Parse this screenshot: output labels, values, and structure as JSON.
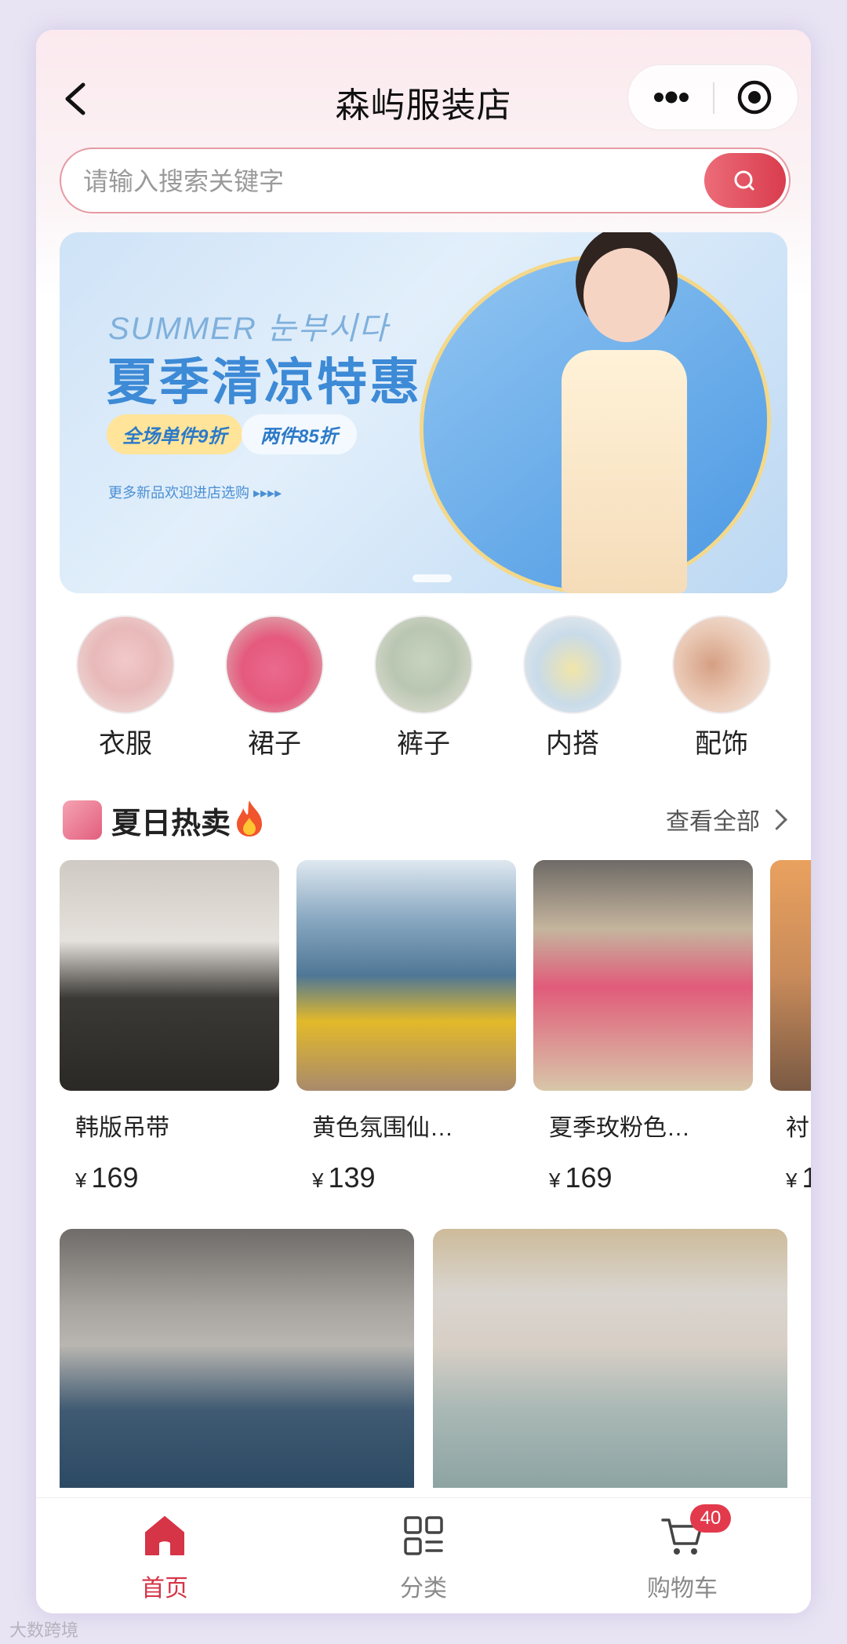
{
  "header": {
    "title": "森屿服装店"
  },
  "search": {
    "placeholder": "请输入搜索关键字"
  },
  "banner": {
    "script_text": "SUMMER 눈부시다",
    "headline": "夏季清凉特惠",
    "promo_1": "全场单件9折",
    "promo_2": "两件85折",
    "subtext": "更多新品欢迎进店选购 ▸▸▸▸"
  },
  "categories": [
    {
      "label": "衣服",
      "color": "#e8b9b9"
    },
    {
      "label": "裙子",
      "color": "#e5597e"
    },
    {
      "label": "裤子",
      "color": "#b9c6b1"
    },
    {
      "label": "内搭",
      "color": "#c9dbe9"
    },
    {
      "label": "配饰",
      "color": "#e9c7b3"
    }
  ],
  "section": {
    "title": "夏日热卖",
    "view_all": "查看全部"
  },
  "products": [
    {
      "name": "韩版吊带",
      "currency": "¥",
      "price": "169",
      "color": "#d8d4cf"
    },
    {
      "name": "黄色氛围仙…",
      "currency": "¥",
      "price": "139",
      "color": "#5f86a6"
    },
    {
      "name": "夏季玫粉色…",
      "currency": "¥",
      "price": "169",
      "color": "#d87f85"
    },
    {
      "name": "衬",
      "currency": "¥",
      "price": "1",
      "color": "#c98b5a"
    }
  ],
  "big_cards": [
    {
      "color": "#7d8e9a"
    },
    {
      "color": "#c9c7c3"
    }
  ],
  "tabbar": {
    "home": "首页",
    "category": "分类",
    "cart": "购物车",
    "cart_count": "40"
  },
  "colors": {
    "accent": "#d63447"
  },
  "watermark": "大数跨境"
}
